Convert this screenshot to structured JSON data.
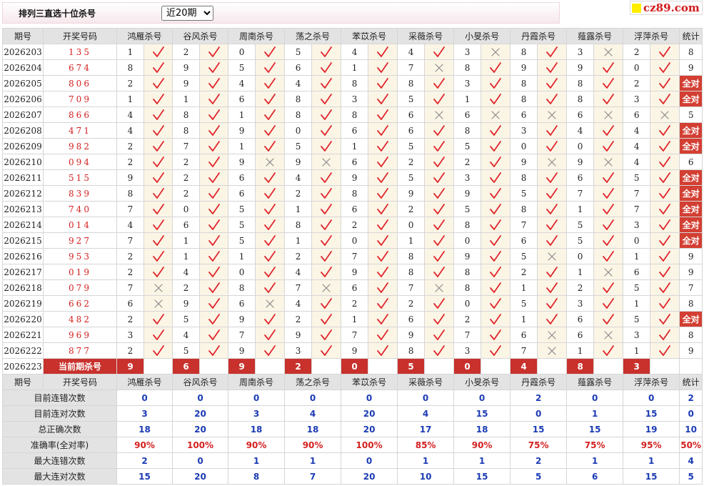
{
  "title": "排列三直选十位杀号",
  "period_selected": "近20期",
  "logo_text": "cz89.com",
  "headers": [
    "期号",
    "开奖号码",
    "鸿雁杀号",
    "谷风杀号",
    "周南杀号",
    "荡之杀号",
    "苯苡杀号",
    "采薇杀号",
    "小旻杀号",
    "丹霞杀号",
    "薤露杀号",
    "浮萍杀号",
    "统计"
  ],
  "all_ok_label": "全对",
  "rows": [
    {
      "issue": "2026203",
      "draw": "135",
      "kills": [
        1,
        2,
        0,
        5,
        4,
        4,
        3,
        8,
        3,
        2
      ],
      "ok": [
        1,
        1,
        1,
        1,
        1,
        1,
        0,
        1,
        0,
        1
      ],
      "stat": "8"
    },
    {
      "issue": "2026204",
      "draw": "674",
      "kills": [
        8,
        9,
        5,
        6,
        1,
        7,
        8,
        9,
        9,
        0
      ],
      "ok": [
        1,
        1,
        1,
        1,
        1,
        0,
        1,
        1,
        1,
        1
      ],
      "stat": "9"
    },
    {
      "issue": "2026205",
      "draw": "806",
      "kills": [
        2,
        9,
        4,
        4,
        8,
        8,
        3,
        8,
        8,
        2
      ],
      "ok": [
        1,
        1,
        1,
        1,
        1,
        1,
        1,
        1,
        1,
        1
      ],
      "stat": "全对"
    },
    {
      "issue": "2026206",
      "draw": "709",
      "kills": [
        1,
        1,
        6,
        8,
        3,
        5,
        1,
        8,
        8,
        3
      ],
      "ok": [
        1,
        1,
        1,
        1,
        1,
        1,
        1,
        1,
        1,
        1
      ],
      "stat": "全对"
    },
    {
      "issue": "2026207",
      "draw": "866",
      "kills": [
        4,
        8,
        1,
        8,
        8,
        6,
        6,
        6,
        6,
        6
      ],
      "ok": [
        1,
        1,
        1,
        1,
        1,
        0,
        0,
        0,
        0,
        0
      ],
      "stat": "5"
    },
    {
      "issue": "2026208",
      "draw": "471",
      "kills": [
        4,
        8,
        9,
        0,
        6,
        6,
        8,
        3,
        4,
        4
      ],
      "ok": [
        1,
        1,
        1,
        1,
        1,
        1,
        1,
        1,
        1,
        1
      ],
      "stat": "全对"
    },
    {
      "issue": "2026209",
      "draw": "982",
      "kills": [
        2,
        7,
        1,
        5,
        1,
        5,
        5,
        0,
        0,
        4
      ],
      "ok": [
        1,
        1,
        1,
        1,
        1,
        1,
        1,
        1,
        1,
        1
      ],
      "stat": "全对"
    },
    {
      "issue": "2026210",
      "draw": "094",
      "kills": [
        2,
        2,
        9,
        9,
        6,
        2,
        2,
        9,
        9,
        4
      ],
      "ok": [
        1,
        1,
        0,
        0,
        1,
        1,
        1,
        0,
        0,
        1
      ],
      "stat": "6"
    },
    {
      "issue": "2026211",
      "draw": "515",
      "kills": [
        9,
        2,
        6,
        4,
        9,
        5,
        3,
        8,
        6,
        5
      ],
      "ok": [
        1,
        1,
        1,
        1,
        1,
        1,
        1,
        1,
        1,
        1
      ],
      "stat": "全对"
    },
    {
      "issue": "2026212",
      "draw": "839",
      "kills": [
        8,
        2,
        6,
        2,
        8,
        9,
        9,
        5,
        7,
        7
      ],
      "ok": [
        1,
        1,
        1,
        1,
        1,
        1,
        1,
        1,
        1,
        1
      ],
      "stat": "全对"
    },
    {
      "issue": "2026213",
      "draw": "740",
      "kills": [
        7,
        0,
        5,
        1,
        6,
        2,
        5,
        8,
        1,
        7
      ],
      "ok": [
        1,
        1,
        1,
        1,
        1,
        1,
        1,
        1,
        1,
        1
      ],
      "stat": "全对"
    },
    {
      "issue": "2026214",
      "draw": "014",
      "kills": [
        4,
        6,
        5,
        8,
        2,
        0,
        8,
        7,
        5,
        3
      ],
      "ok": [
        1,
        1,
        1,
        1,
        1,
        1,
        1,
        1,
        1,
        1
      ],
      "stat": "全对"
    },
    {
      "issue": "2026215",
      "draw": "927",
      "kills": [
        7,
        1,
        5,
        1,
        0,
        1,
        0,
        6,
        5,
        0
      ],
      "ok": [
        1,
        1,
        1,
        1,
        1,
        1,
        1,
        1,
        1,
        1
      ],
      "stat": "全对"
    },
    {
      "issue": "2026216",
      "draw": "953",
      "kills": [
        2,
        1,
        1,
        2,
        7,
        8,
        9,
        5,
        0,
        1
      ],
      "ok": [
        1,
        1,
        1,
        1,
        1,
        1,
        1,
        0,
        1,
        1
      ],
      "stat": "9"
    },
    {
      "issue": "2026217",
      "draw": "019",
      "kills": [
        2,
        4,
        0,
        4,
        9,
        8,
        8,
        2,
        1,
        6
      ],
      "ok": [
        1,
        1,
        1,
        1,
        1,
        1,
        1,
        1,
        0,
        1
      ],
      "stat": "9"
    },
    {
      "issue": "2026218",
      "draw": "079",
      "kills": [
        7,
        2,
        8,
        7,
        6,
        7,
        8,
        1,
        2,
        5
      ],
      "ok": [
        0,
        1,
        1,
        0,
        1,
        0,
        1,
        1,
        1,
        1
      ],
      "stat": "7"
    },
    {
      "issue": "2026219",
      "draw": "662",
      "kills": [
        6,
        9,
        6,
        4,
        2,
        2,
        0,
        5,
        3,
        1
      ],
      "ok": [
        0,
        1,
        0,
        1,
        1,
        1,
        1,
        1,
        1,
        1
      ],
      "stat": "8"
    },
    {
      "issue": "2026220",
      "draw": "482",
      "kills": [
        2,
        5,
        9,
        2,
        1,
        6,
        2,
        1,
        6,
        5
      ],
      "ok": [
        1,
        1,
        1,
        1,
        1,
        1,
        1,
        1,
        1,
        1
      ],
      "stat": "全对"
    },
    {
      "issue": "2026221",
      "draw": "969",
      "kills": [
        3,
        4,
        7,
        9,
        7,
        9,
        7,
        6,
        6,
        3
      ],
      "ok": [
        1,
        1,
        1,
        1,
        1,
        1,
        1,
        0,
        0,
        1
      ],
      "stat": "8"
    },
    {
      "issue": "2026222",
      "draw": "877",
      "kills": [
        2,
        5,
        9,
        3,
        9,
        8,
        3,
        7,
        1,
        1
      ],
      "ok": [
        1,
        1,
        1,
        1,
        1,
        1,
        1,
        0,
        1,
        1
      ],
      "stat": "9"
    }
  ],
  "current": {
    "issue": "2026223",
    "label": "当前期杀号",
    "kills": [
      9,
      6,
      9,
      2,
      0,
      5,
      0,
      4,
      8,
      3
    ]
  },
  "stats": [
    {
      "label": "目前连错次数",
      "values": [
        "0",
        "0",
        "0",
        "0",
        "0",
        "0",
        "0",
        "2",
        "0",
        "0",
        "2"
      ]
    },
    {
      "label": "目前连对次数",
      "values": [
        "3",
        "20",
        "3",
        "4",
        "20",
        "4",
        "15",
        "0",
        "1",
        "15",
        "0"
      ]
    },
    {
      "label": "总正确次数",
      "values": [
        "18",
        "20",
        "18",
        "18",
        "20",
        "17",
        "18",
        "15",
        "15",
        "19",
        "10"
      ]
    },
    {
      "label": "准确率(全对率)",
      "values": [
        "90%",
        "100%",
        "90%",
        "90%",
        "100%",
        "85%",
        "90%",
        "75%",
        "75%",
        "95%",
        "50%"
      ]
    },
    {
      "label": "最大连错次数",
      "values": [
        "2",
        "0",
        "1",
        "1",
        "0",
        "1",
        "1",
        "2",
        "1",
        "1",
        "4"
      ]
    },
    {
      "label": "最大连对次数",
      "values": [
        "15",
        "20",
        "8",
        "7",
        "20",
        "10",
        "15",
        "5",
        "6",
        "15",
        "5"
      ]
    }
  ],
  "colors": {
    "tick": "#e0262b",
    "cross": "#8c8c8c",
    "accent": "#c8312c",
    "stat_blue": "#1b3bb4"
  }
}
